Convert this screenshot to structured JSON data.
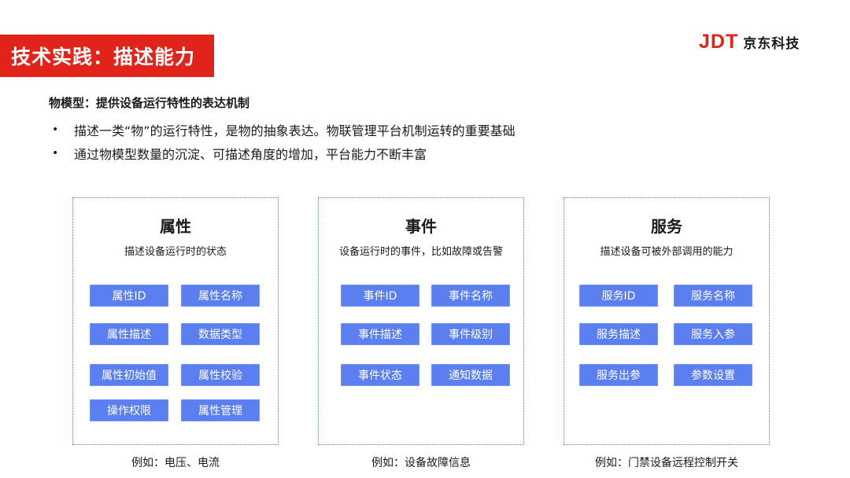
{
  "header": {
    "title": "技术实践：描述能力",
    "logo_mark": "JDT",
    "logo_text": "京东科技"
  },
  "intro": {
    "subtitle": "物模型：提供设备运行特性的表达机制",
    "bullets": [
      "描述一类“物”的运行特性，是物的抽象表达。物联管理平台机制运转的重要基础",
      "通过物模型数量的沉淀、可描述角度的增加，平台能力不断丰富"
    ],
    "bullet_symbol": "•"
  },
  "cards": [
    {
      "title": "属性",
      "desc": "描述设备运行时的状态",
      "tags": [
        "属性ID",
        "属性名称",
        "属性描述",
        "数据类型",
        "属性初始值",
        "属性校验",
        "操作权限",
        "属性管理"
      ],
      "example": "例如：电压、电流"
    },
    {
      "title": "事件",
      "desc": "设备运行时的事件，比如故障或告警",
      "tags": [
        "事件ID",
        "事件名称",
        "事件描述",
        "事件级别",
        "事件状态",
        "通知数据"
      ],
      "example": "例如：设备故障信息"
    },
    {
      "title": "服务",
      "desc": "描述设备可被外部调用的能力",
      "tags": [
        "服务ID",
        "服务名称",
        "服务描述",
        "服务入参",
        "服务出参",
        "参数设置"
      ],
      "example": "例如：门禁设备远程控制开关"
    }
  ],
  "colors": {
    "brand_red": "#e2231a",
    "tag_blue": "#5b7ff0",
    "card_border": "#4a78d6"
  }
}
